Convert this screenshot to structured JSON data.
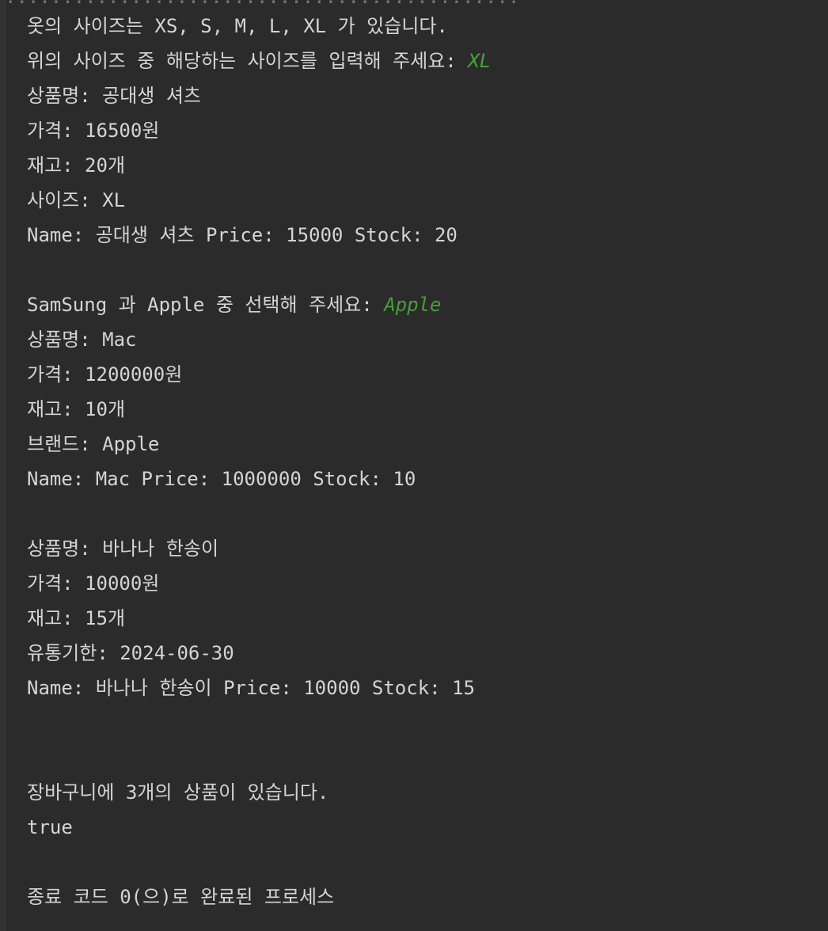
{
  "top_partial_line": ".....,.......,....,.......,.....,..,...,..,.,",
  "console_lines": [
    {
      "text": "옷의 사이즈는 XS, S, M, L, XL 가 있습니다.",
      "input": ""
    },
    {
      "text": "위의 사이즈 중 해당하는 사이즈를 입력해 주세요: ",
      "input": "XL"
    },
    {
      "text": "상품명: 공대생 셔츠",
      "input": ""
    },
    {
      "text": "가격: 16500원",
      "input": ""
    },
    {
      "text": "재고: 20개",
      "input": ""
    },
    {
      "text": "사이즈: XL",
      "input": ""
    },
    {
      "text": "Name: 공대생 셔츠 Price: 15000 Stock: 20",
      "input": ""
    },
    {
      "text": "",
      "input": ""
    },
    {
      "text": "SamSung 과 Apple 중 선택해 주세요: ",
      "input": "Apple"
    },
    {
      "text": "상품명: Mac",
      "input": ""
    },
    {
      "text": "가격: 1200000원",
      "input": ""
    },
    {
      "text": "재고: 10개",
      "input": ""
    },
    {
      "text": "브랜드: Apple",
      "input": ""
    },
    {
      "text": "Name: Mac Price: 1000000 Stock: 10",
      "input": ""
    },
    {
      "text": "",
      "input": ""
    },
    {
      "text": "상품명: 바나나 한송이",
      "input": ""
    },
    {
      "text": "가격: 10000원",
      "input": ""
    },
    {
      "text": "재고: 15개",
      "input": ""
    },
    {
      "text": "유통기한: 2024-06-30",
      "input": ""
    },
    {
      "text": "Name: 바나나 한송이 Price: 10000 Stock: 15",
      "input": ""
    },
    {
      "text": "",
      "input": ""
    },
    {
      "text": "",
      "input": ""
    },
    {
      "text": "장바구니에 3개의 상품이 있습니다.",
      "input": ""
    },
    {
      "text": "true",
      "input": ""
    },
    {
      "text": "",
      "input": ""
    },
    {
      "text": "종료 코드 0(으)로 완료된 프로세스",
      "input": ""
    }
  ],
  "colors": {
    "background": "#2b2b2b",
    "text": "#d4d4d4",
    "user_input": "#4a9e3a"
  }
}
